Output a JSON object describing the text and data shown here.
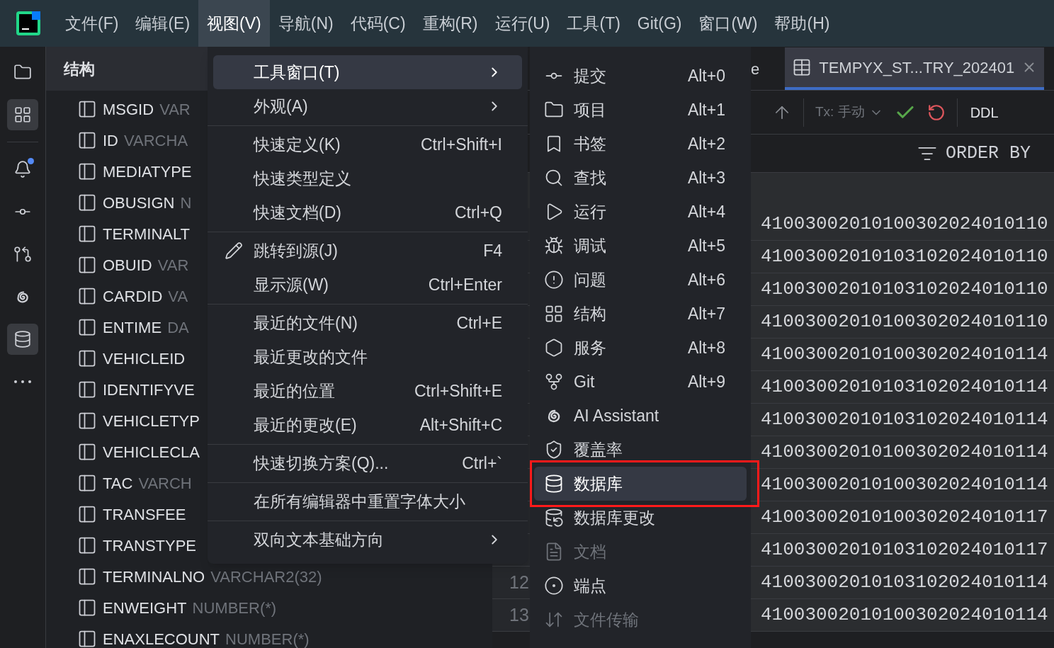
{
  "menubar": {
    "items": [
      {
        "label": "文件(F)",
        "selected": false
      },
      {
        "label": "编辑(E)",
        "selected": false
      },
      {
        "label": "视图(V)",
        "selected": true
      },
      {
        "label": "导航(N)",
        "selected": false
      },
      {
        "label": "代码(C)",
        "selected": false
      },
      {
        "label": "重构(R)",
        "selected": false
      },
      {
        "label": "运行(U)",
        "selected": false
      },
      {
        "label": "工具(T)",
        "selected": false
      },
      {
        "label": "Git(G)",
        "selected": false
      },
      {
        "label": "窗口(W)",
        "selected": false
      },
      {
        "label": "帮助(H)",
        "selected": false
      }
    ]
  },
  "tool_strip": [
    {
      "selected": false,
      "badge": false
    },
    {
      "selected": true,
      "badge": false
    },
    {
      "selected": false,
      "badge": true
    },
    {
      "selected": false,
      "badge": false
    },
    {
      "selected": false,
      "badge": false
    },
    {
      "selected": false,
      "badge": false
    },
    {
      "selected": true,
      "badge": false
    },
    {
      "selected": false,
      "badge": false
    }
  ],
  "structure": {
    "title": "结构",
    "columns": [
      {
        "name": "MSGID",
        "type": "VAR"
      },
      {
        "name": "ID",
        "type": "VARCHA"
      },
      {
        "name": "MEDIATYPE"
      },
      {
        "name": "OBUSIGN",
        "type": "N"
      },
      {
        "name": "TERMINALT"
      },
      {
        "name": "OBUID",
        "type": "VAR"
      },
      {
        "name": "CARDID",
        "type": "VA"
      },
      {
        "name": "ENTIME",
        "type": "DA"
      },
      {
        "name": "VEHICLEID"
      },
      {
        "name": "IDENTIFYVE"
      },
      {
        "name": "VEHICLETYP"
      },
      {
        "name": "VEHICLECLA"
      },
      {
        "name": "TAC",
        "type": "VARCH"
      },
      {
        "name": "TRANSFEE"
      },
      {
        "name": "TRANSTYPE"
      },
      {
        "name": "TERMINALNO",
        "type": "VARCHAR2(32)"
      },
      {
        "name": "ENWEIGHT",
        "type": "NUMBER(*)"
      },
      {
        "name": "ENAXLECOUNT",
        "type": "NUMBER(*)"
      }
    ]
  },
  "editor": {
    "tabs": [
      {
        "label": "e",
        "selected": false
      },
      {
        "label": "TEMPYX_ST...TRY_202401",
        "selected": true
      }
    ],
    "toolbar": {
      "tx": "Tx: 手动",
      "ddl": "DDL"
    },
    "order_by": "ORDER BY",
    "rows": [
      {
        "value": "41003002010100302024010110"
      },
      {
        "value": "41003002010103102024010110"
      },
      {
        "value": "41003002010103102024010110"
      },
      {
        "value": "41003002010100302024010110"
      },
      {
        "value": "41003002010100302024010114"
      },
      {
        "value": "41003002010103102024010114"
      },
      {
        "value": "41003002010103102024010114"
      },
      {
        "value": "41003002010100302024010114"
      },
      {
        "value": "41003002010100302024010114"
      },
      {
        "value": "41003002010100302024010117"
      },
      {
        "value": "41003002010103102024010117"
      },
      {
        "number": "12",
        "value": "41003002010103102024010114"
      },
      {
        "number": "13",
        "value": "41003002010100302024010114"
      }
    ]
  },
  "view_menu": {
    "groups": [
      [
        {
          "label": "工具窗口(T)",
          "selected": true,
          "submenu": true
        },
        {
          "label": "外观(A)",
          "selected": false,
          "submenu": true
        }
      ],
      [
        {
          "label": "快速定义(K)",
          "shortcut": "Ctrl+Shift+I",
          "selected": false,
          "submenu": false
        },
        {
          "label": "快速类型定义",
          "selected": false,
          "submenu": false
        },
        {
          "label": "快速文档(D)",
          "shortcut": "Ctrl+Q",
          "selected": false,
          "submenu": false
        }
      ],
      [
        {
          "label": "跳转到源(J)",
          "shortcut": "F4",
          "selected": false,
          "submenu": false
        },
        {
          "label": "显示源(W)",
          "shortcut": "Ctrl+Enter",
          "selected": false,
          "submenu": false
        }
      ],
      [
        {
          "label": "最近的文件(N)",
          "shortcut": "Ctrl+E",
          "selected": false,
          "submenu": false
        },
        {
          "label": "最近更改的文件",
          "selected": false,
          "submenu": false
        },
        {
          "label": "最近的位置",
          "shortcut": "Ctrl+Shift+E",
          "selected": false,
          "submenu": false
        },
        {
          "label": "最近的更改(E)",
          "shortcut": "Alt+Shift+C",
          "selected": false,
          "submenu": false
        }
      ],
      [
        {
          "label": "快速切换方案(Q)...",
          "shortcut": "Ctrl+`",
          "selected": false,
          "submenu": false
        }
      ],
      [
        {
          "label": "在所有编辑器中重置字体大小",
          "selected": false,
          "submenu": false
        }
      ],
      [
        {
          "label": "双向文本基础方向",
          "selected": false,
          "submenu": true
        }
      ]
    ]
  },
  "tool_windows_menu": {
    "items": [
      {
        "label": "提交",
        "shortcut": "Alt+0",
        "selected": false,
        "disabled": false
      },
      {
        "label": "项目",
        "shortcut": "Alt+1",
        "selected": false,
        "disabled": false
      },
      {
        "label": "书签",
        "shortcut": "Alt+2",
        "selected": false,
        "disabled": false
      },
      {
        "label": "查找",
        "shortcut": "Alt+3",
        "selected": false,
        "disabled": false
      },
      {
        "label": "运行",
        "shortcut": "Alt+4",
        "selected": false,
        "disabled": false
      },
      {
        "label": "调试",
        "shortcut": "Alt+5",
        "selected": false,
        "disabled": false
      },
      {
        "label": "问题",
        "shortcut": "Alt+6",
        "selected": false,
        "disabled": false
      },
      {
        "label": "结构",
        "shortcut": "Alt+7",
        "selected": false,
        "disabled": false
      },
      {
        "label": "服务",
        "shortcut": "Alt+8",
        "selected": false,
        "disabled": false
      },
      {
        "label": "Git",
        "shortcut": "Alt+9",
        "selected": false,
        "disabled": false
      },
      {
        "label": "AI Assistant",
        "selected": false,
        "disabled": false
      },
      {
        "label": "覆盖率",
        "selected": false,
        "disabled": false
      },
      {
        "label": "数据库",
        "selected": true,
        "disabled": false
      },
      {
        "label": "数据库更改",
        "selected": false,
        "disabled": false
      },
      {
        "label": "文档",
        "selected": false,
        "disabled": true
      },
      {
        "label": "端点",
        "selected": false,
        "disabled": false
      },
      {
        "label": "文件传输",
        "selected": false,
        "disabled": true
      }
    ]
  }
}
